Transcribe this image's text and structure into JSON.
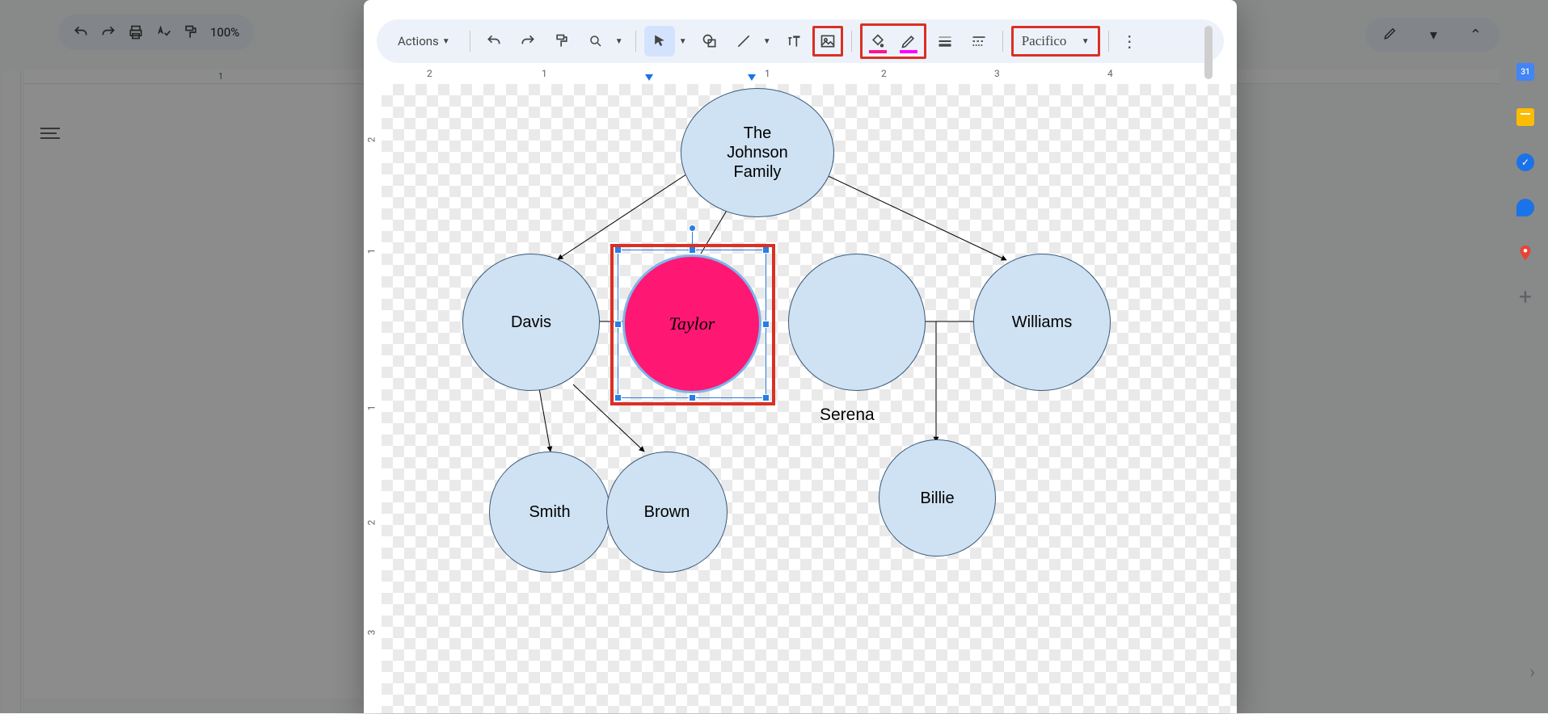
{
  "bg_toolbar": {
    "zoom": "100%",
    "ruler_mark": "1"
  },
  "side_panel": {
    "calendar_day": "31"
  },
  "editor": {
    "actions_label": "Actions",
    "font": "Pacifico",
    "hruler": {
      "m2": "2",
      "m1": "1",
      "p1": "1",
      "p2": "2",
      "p3": "3",
      "p4": "4"
    },
    "vruler": {
      "p2": "2",
      "p1a": "1",
      "p1b": "1",
      "v2": "2",
      "v3": "3"
    }
  },
  "diagram": {
    "root": "The\nJohnson\nFamily",
    "davis": "Davis",
    "taylor": "Taylor",
    "serena_label": "Serena",
    "williams": "Williams",
    "smith": "Smith",
    "brown": "Brown",
    "billie": "Billie"
  }
}
